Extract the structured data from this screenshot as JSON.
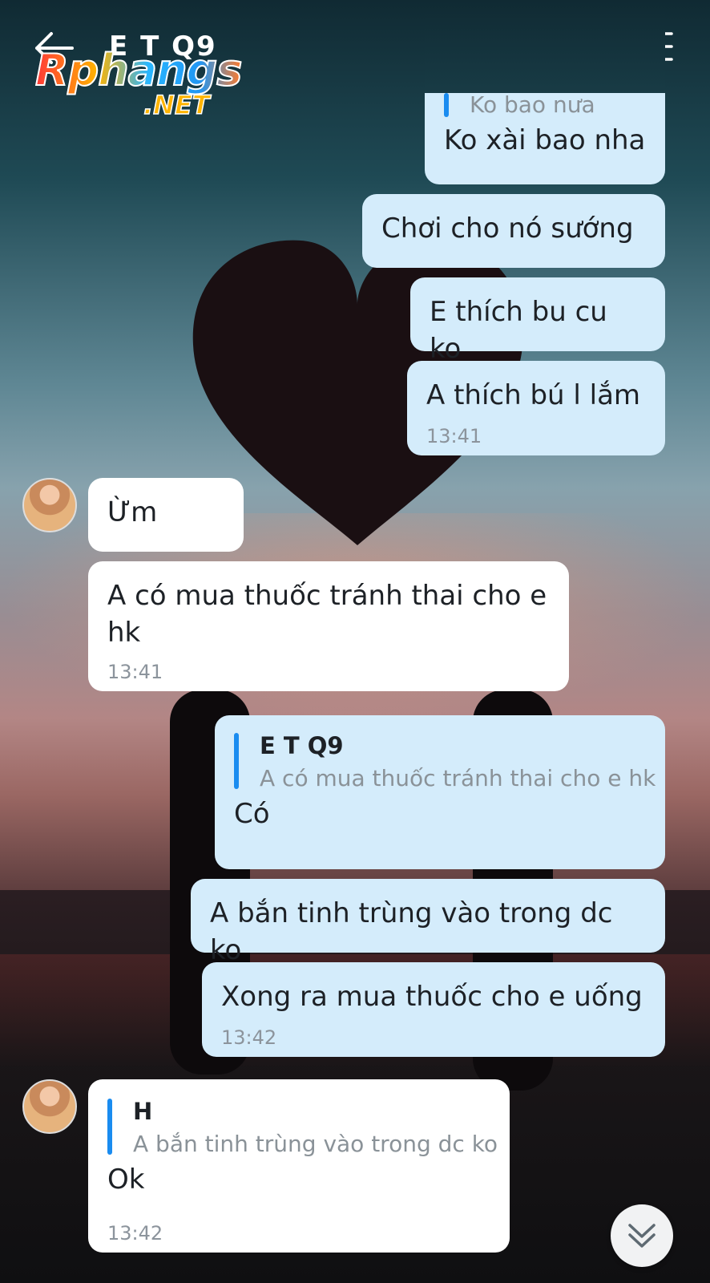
{
  "header": {
    "title": "E T Q9",
    "watermark_main": "Rphangs",
    "watermark_sub": ".NET"
  },
  "messages": [
    {
      "reply": "Ko bao nưa",
      "text": "Ko xài bao nha"
    },
    {
      "text": "Chơi cho nó sướng"
    },
    {
      "text": "E thích bu cu ko"
    },
    {
      "text": "A thích bú l lắm",
      "time": "13:41"
    },
    {
      "text": "Ừm"
    },
    {
      "text": "A có mua thuốc tránh thai cho e hk",
      "time": "13:41"
    },
    {
      "quote_name": "E T Q9",
      "quote_text": "A có mua thuốc tránh thai cho e hk",
      "text": "Có"
    },
    {
      "text": "A bắn tinh trùng vào trong dc ko"
    },
    {
      "text": "Xong ra mua thuốc cho e uống",
      "time": "13:42"
    },
    {
      "quote_name": "H",
      "quote_text": "A bắn tinh trùng vào trong dc ko",
      "text": "Ok",
      "time": "13:42"
    }
  ],
  "colors": {
    "outgoing_bubble": "#d4ecfb",
    "incoming_bubble": "#ffffff",
    "quote_bar": "#1a8cf0"
  },
  "icons": [
    "back-arrow-icon",
    "phone-icon",
    "video-call-icon",
    "menu-list-icon",
    "scroll-down-icon"
  ]
}
